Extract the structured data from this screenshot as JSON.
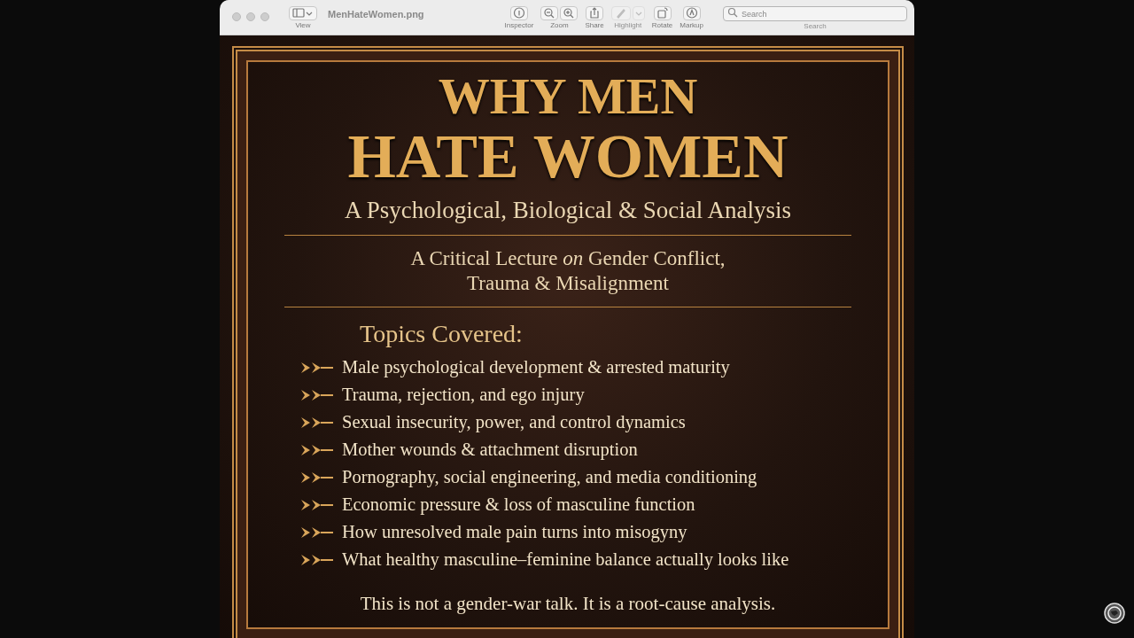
{
  "window": {
    "title": "MenHateWomen.png"
  },
  "toolbar": {
    "items": [
      {
        "kind": "view",
        "label": "View",
        "disabled": false
      },
      {
        "kind": "inspector",
        "label": "Inspector",
        "disabled": false
      },
      {
        "kind": "zoom",
        "label": "Zoom",
        "disabled": false
      },
      {
        "kind": "share",
        "label": "Share",
        "disabled": false
      },
      {
        "kind": "highlight",
        "label": "Highlight",
        "disabled": true
      },
      {
        "kind": "rotate",
        "label": "Rotate",
        "disabled": false
      },
      {
        "kind": "markup",
        "label": "Markup",
        "disabled": false
      }
    ],
    "search": {
      "placeholder": "Search",
      "label": "Search"
    }
  },
  "poster": {
    "title_lines": [
      "WHY MEN",
      "HATE WOMEN"
    ],
    "subtitle": "A Psychological, Biological & Social Analysis",
    "lecture_lines": [
      "A Critical Lecture *on* Gender Conflict,",
      "Trauma & Misalignment"
    ],
    "topics_heading": "Topics Covered:",
    "topics": [
      "Male psychological development & arrested maturity",
      "Trauma, rejection, and ego injury",
      "Sexual insecurity, power, and control dynamics",
      "Mother wounds & attachment disruption",
      "Pornography, social engineering, and media conditioning",
      "Economic pressure & loss of masculine function",
      "How unresolved male pain turns into misogyny",
      "What healthy masculine–feminine balance actually looks like"
    ],
    "footer": "This is not a gender-war talk. It is a root-cause analysis."
  }
}
